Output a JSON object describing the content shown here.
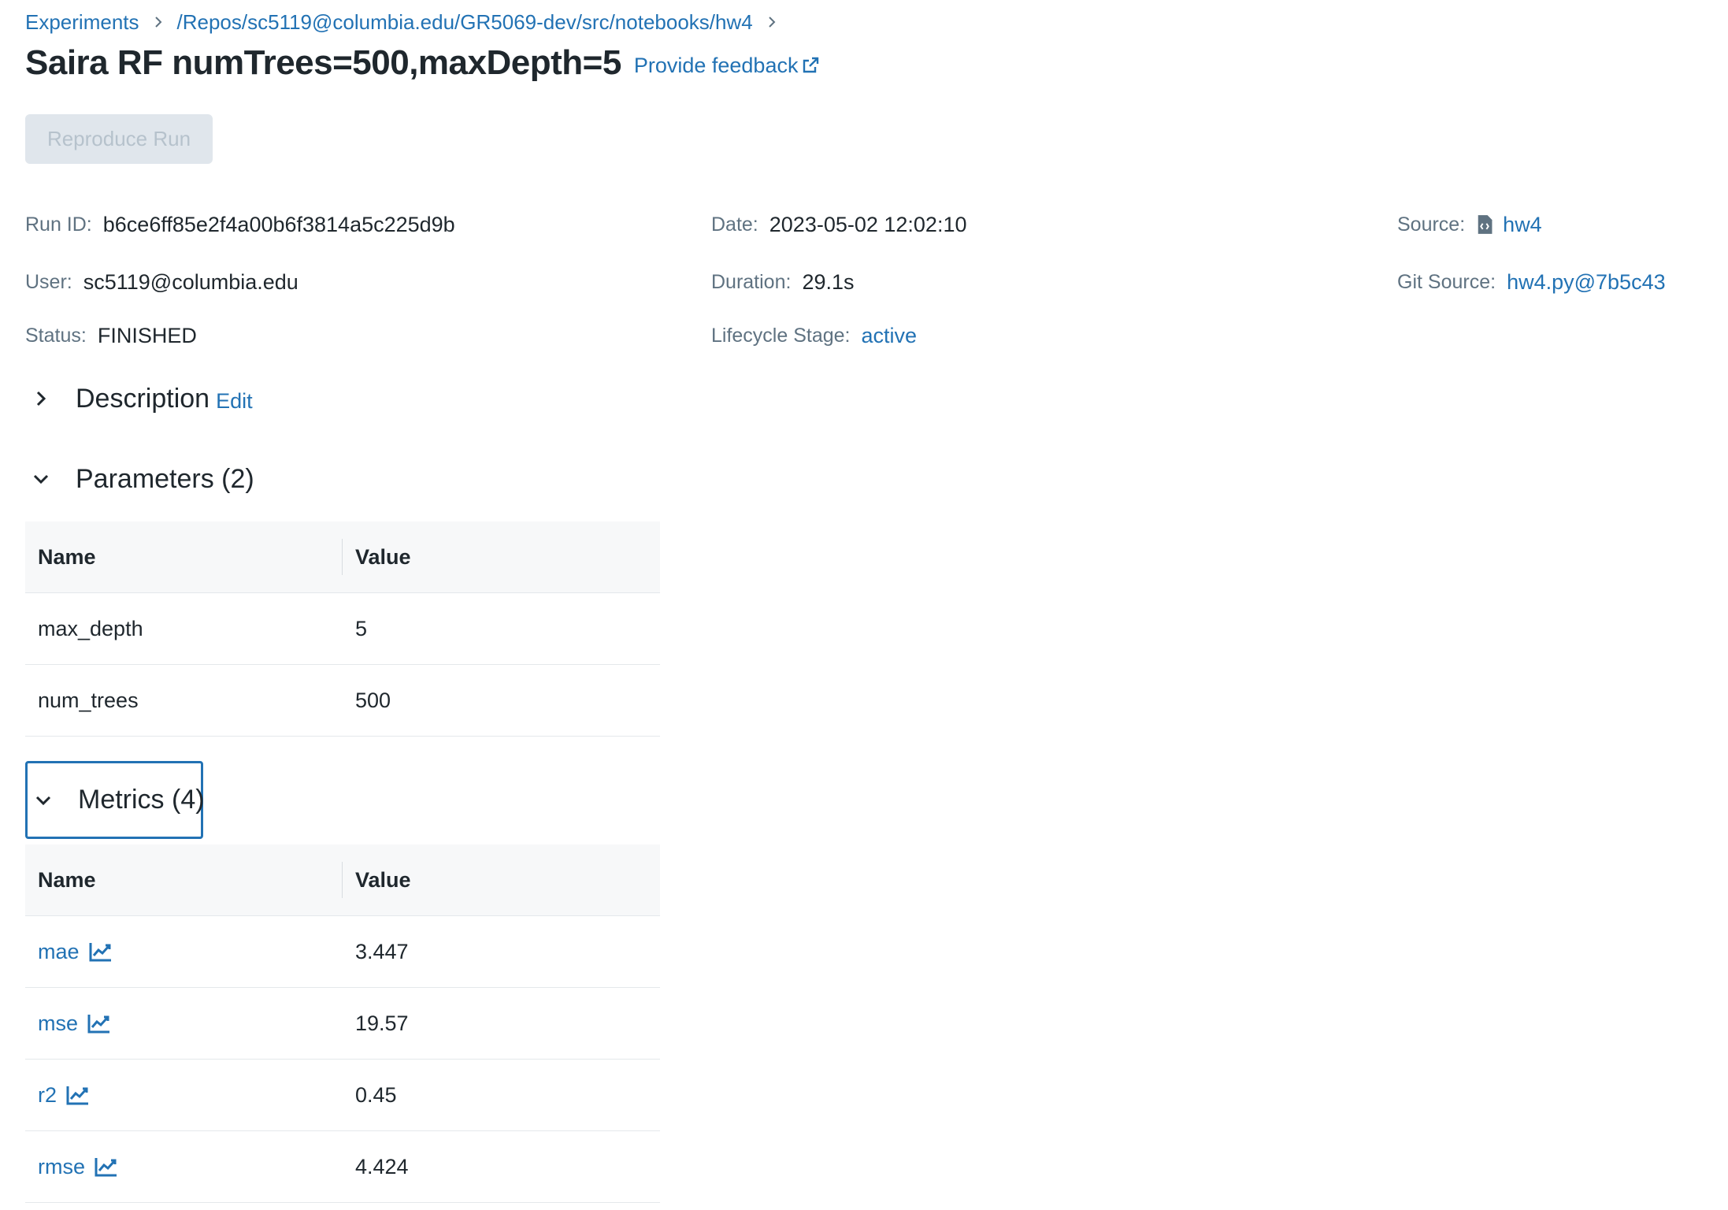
{
  "breadcrumb": {
    "items": [
      "Experiments",
      "/Repos/sc5119@columbia.edu/GR5069-dev/src/notebooks/hw4"
    ]
  },
  "header": {
    "title": "Saira RF numTrees=500,maxDepth=5",
    "feedback_label": "Provide feedback"
  },
  "actions": {
    "reproduce_label": "Reproduce Run"
  },
  "run_info": {
    "run_id_label": "Run ID:",
    "run_id": "b6ce6ff85e2f4a00b6f3814a5c225d9b",
    "date_label": "Date:",
    "date": "2023-05-02 12:02:10",
    "source_label": "Source:",
    "source": "hw4",
    "user_label": "User:",
    "user": "sc5119@columbia.edu",
    "duration_label": "Duration:",
    "duration": "29.1s",
    "git_source_label": "Git Source:",
    "git_source": "hw4.py@7b5c43",
    "status_label": "Status:",
    "status": "FINISHED",
    "lifecycle_label": "Lifecycle Stage:",
    "lifecycle": "active"
  },
  "description": {
    "label": "Description",
    "edit_label": "Edit",
    "expanded": false
  },
  "parameters": {
    "label": "Parameters (2)",
    "expanded": true,
    "headers": [
      "Name",
      "Value"
    ],
    "rows": [
      {
        "name": "max_depth",
        "value": "5"
      },
      {
        "name": "num_trees",
        "value": "500"
      }
    ]
  },
  "metrics": {
    "label": "Metrics (4)",
    "expanded": true,
    "headers": [
      "Name",
      "Value"
    ],
    "rows": [
      {
        "name": "mae",
        "value": "3.447",
        "icon": "chart-line-icon"
      },
      {
        "name": "mse",
        "value": "19.57",
        "icon": "chart-line-icon"
      },
      {
        "name": "r2",
        "value": "0.45",
        "icon": "chart-line-icon"
      },
      {
        "name": "rmse",
        "value": "4.424",
        "icon": "chart-line-icon"
      }
    ]
  },
  "colors": {
    "link": "#2272b4",
    "text": "#1f272d",
    "muted": "#5f7281",
    "disabled_bg": "#e0e6ec"
  }
}
